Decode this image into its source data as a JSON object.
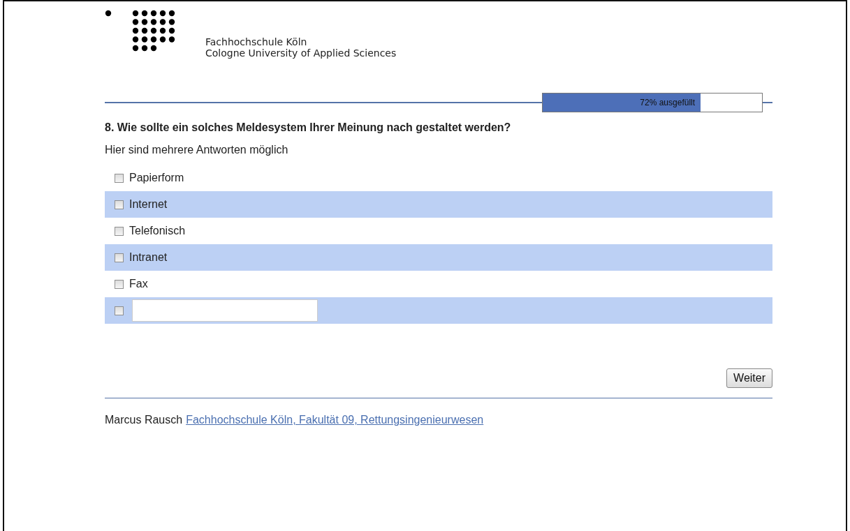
{
  "header": {
    "name": "Fachhochschule Köln",
    "subtitle": "Cologne University of Applied Sciences"
  },
  "progress": {
    "label": "72% ausgefüllt",
    "level": 0.72
  },
  "question": {
    "title": "8. Wie sollte ein solches Meldesystem Ihrer Meinung nach gestaltet werden?",
    "hint": "Hier sind mehrere Antworten möglich"
  },
  "options": [
    {
      "kind": "option",
      "label": "Papierform",
      "checked": false
    },
    {
      "kind": "option",
      "label": "Internet",
      "checked": false
    },
    {
      "kind": "option",
      "label": "Telefonisch",
      "checked": false
    },
    {
      "kind": "option",
      "label": "Intranet",
      "checked": false
    },
    {
      "kind": "option",
      "label": "Fax",
      "checked": false
    },
    {
      "kind": "other",
      "checked": false
    }
  ],
  "button": "Weiter",
  "footer": {
    "author": "Marcus Rausch",
    "link": "Fachhochschule Köln, Fakultät 09, Rettungsingenieurwesen"
  }
}
